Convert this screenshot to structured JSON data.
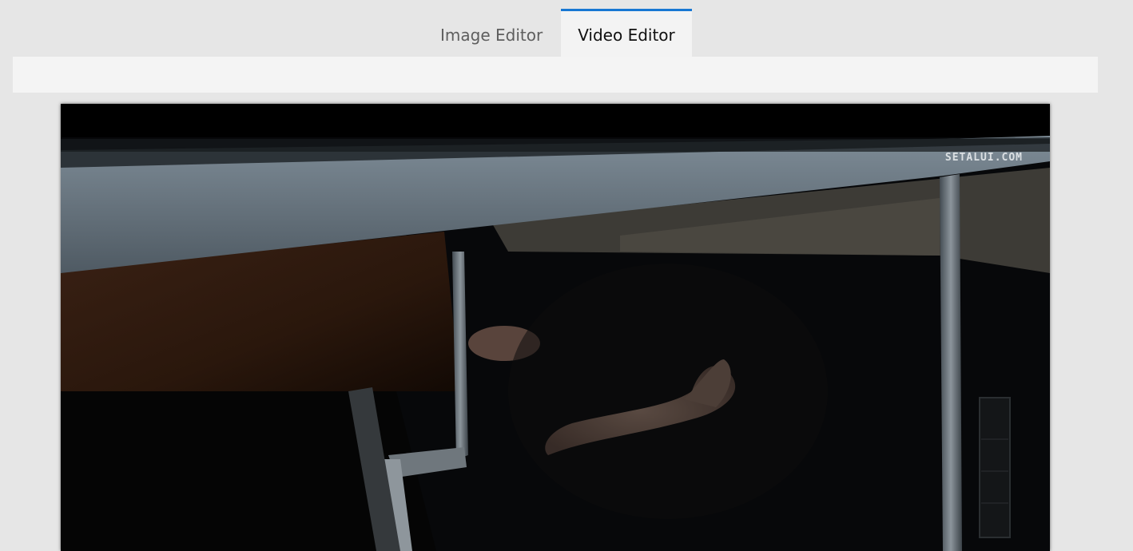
{
  "tabs": [
    {
      "label": "Image Editor",
      "active": false
    },
    {
      "label": "Video Editor",
      "active": true
    }
  ],
  "video": {
    "watermark": "SETALUI.COM"
  },
  "colors": {
    "background": "#e6e6e6",
    "active_tab_accent": "#1777d3",
    "toolbar": "#f4f4f4",
    "video_background": "#000000"
  }
}
